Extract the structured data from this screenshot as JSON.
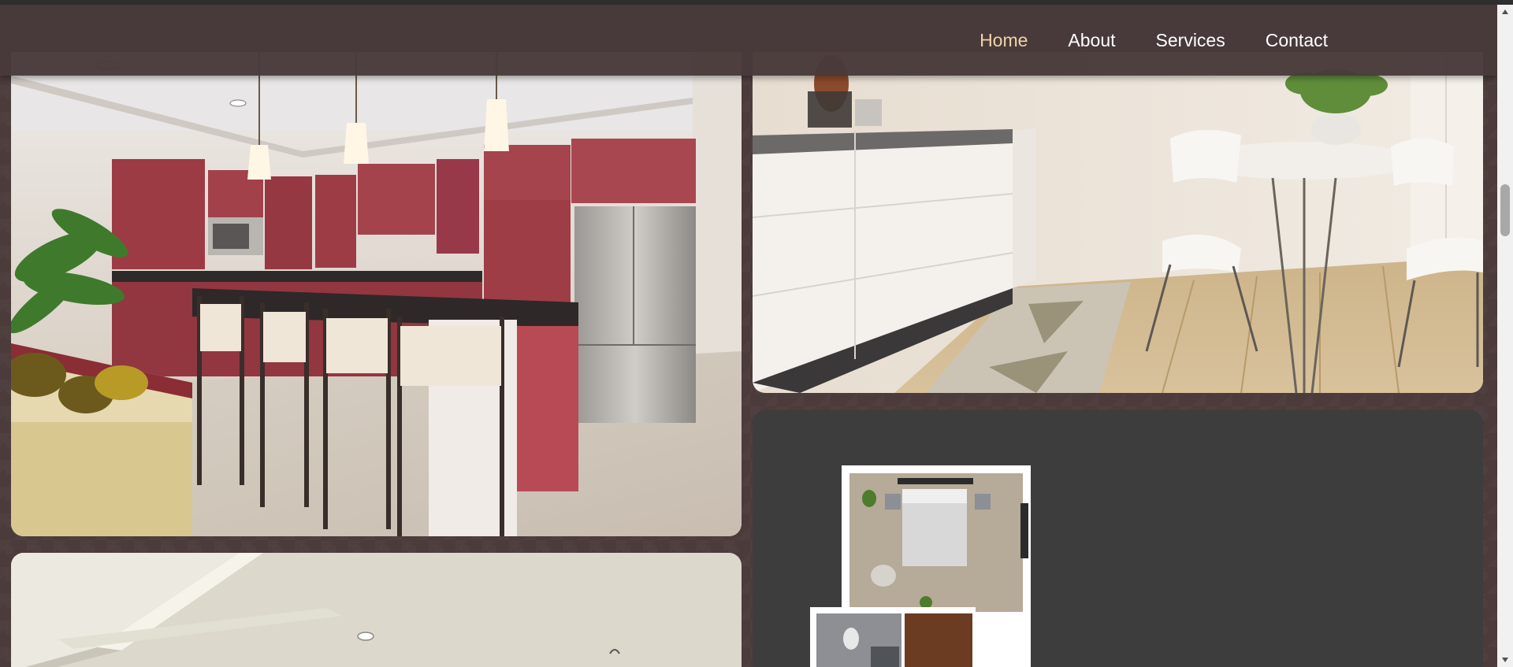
{
  "nav": {
    "items": [
      {
        "label": "Home",
        "active": true
      },
      {
        "label": "About",
        "active": false
      },
      {
        "label": "Services",
        "active": false
      },
      {
        "label": "Contact",
        "active": false
      }
    ]
  },
  "colors": {
    "nav_background": "#483a3a",
    "nav_active": "#f0d3a8",
    "nav_text": "#ffffff",
    "page_background": "#4b3b3b",
    "floorplan_card": "#3d3d3d"
  },
  "gallery": [
    {
      "name": "kitchen-image"
    },
    {
      "name": "dining-image"
    },
    {
      "name": "floorplan-image"
    },
    {
      "name": "ceiling-image"
    }
  ],
  "icons": {
    "scroll_up": "triangle-up-icon",
    "scroll_down": "triangle-down-icon"
  }
}
